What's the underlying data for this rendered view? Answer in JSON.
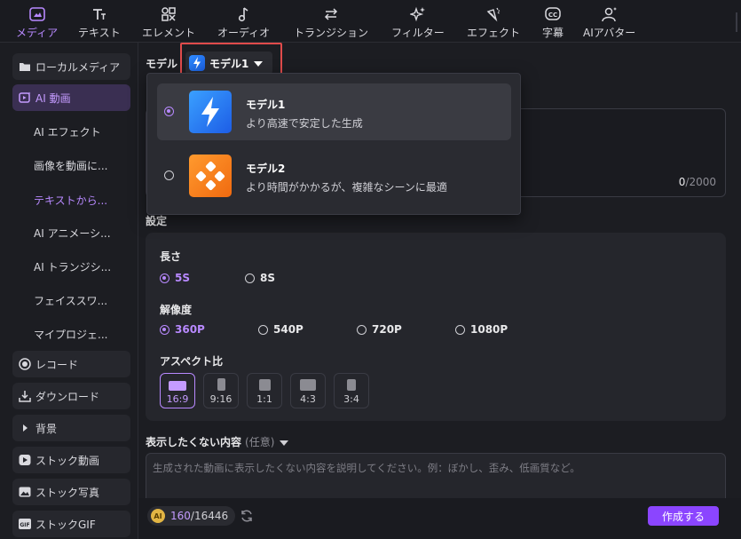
{
  "toolbar": {
    "tabs": [
      {
        "label": "メディア",
        "icon": "media-icon",
        "active": true
      },
      {
        "label": "テキスト",
        "icon": "text-icon"
      },
      {
        "label": "エレメント",
        "icon": "elements-icon"
      },
      {
        "label": "オーディオ",
        "icon": "audio-icon"
      },
      {
        "label": "トランジション",
        "icon": "transition-icon"
      },
      {
        "label": "フィルター",
        "icon": "filter-icon"
      },
      {
        "label": "エフェクト",
        "icon": "effect-icon"
      },
      {
        "label": "字幕",
        "icon": "subtitle-icon"
      },
      {
        "label": "AIアバター",
        "icon": "ai-avatar-icon"
      }
    ]
  },
  "sidebar": {
    "local_media": "ローカルメディア",
    "ai_video": "AI 動画",
    "sub_items": [
      "AI エフェクト",
      "画像を動画に...",
      "テキストから...",
      "AI アニメーシ...",
      "AI トランジシ...",
      "フェイススワ...",
      "マイプロジェ..."
    ],
    "record": "レコード",
    "download": "ダウンロード",
    "background": "背景",
    "stock_video": "ストック動画",
    "stock_photo": "ストック写真",
    "stock_gif": "ストックGIF"
  },
  "model": {
    "label": "モデル",
    "selected": "モデル1",
    "options": [
      {
        "name": "モデル1",
        "desc": "より高速で安定した生成"
      },
      {
        "name": "モデル2",
        "desc": "より時間がかかるが、複雑なシーンに最適"
      }
    ]
  },
  "prompt": {
    "count": "0",
    "max": "/2000"
  },
  "settings": {
    "title": "設定",
    "length_label": "長さ",
    "lengths": [
      "5S",
      "8S"
    ],
    "resolution_label": "解像度",
    "resolutions": [
      "360P",
      "540P",
      "720P",
      "1080P"
    ],
    "aspect_label": "アスペクト比",
    "aspects": [
      "16:9",
      "9:16",
      "1:1",
      "4:3",
      "3:4"
    ]
  },
  "negative": {
    "label": "表示したくない内容",
    "optional": "(任意)",
    "placeholder": "生成された動画に表示したくない内容を説明してください。例：ぼかし、歪み、低画質など。"
  },
  "footer": {
    "coin_label": "AI",
    "credits_used": "160",
    "credits_total": "/16446",
    "create_button": "作成する"
  },
  "colors": {
    "accent": "#b889ff",
    "button": "#8b45ff",
    "highlight": "#e04b4b"
  }
}
